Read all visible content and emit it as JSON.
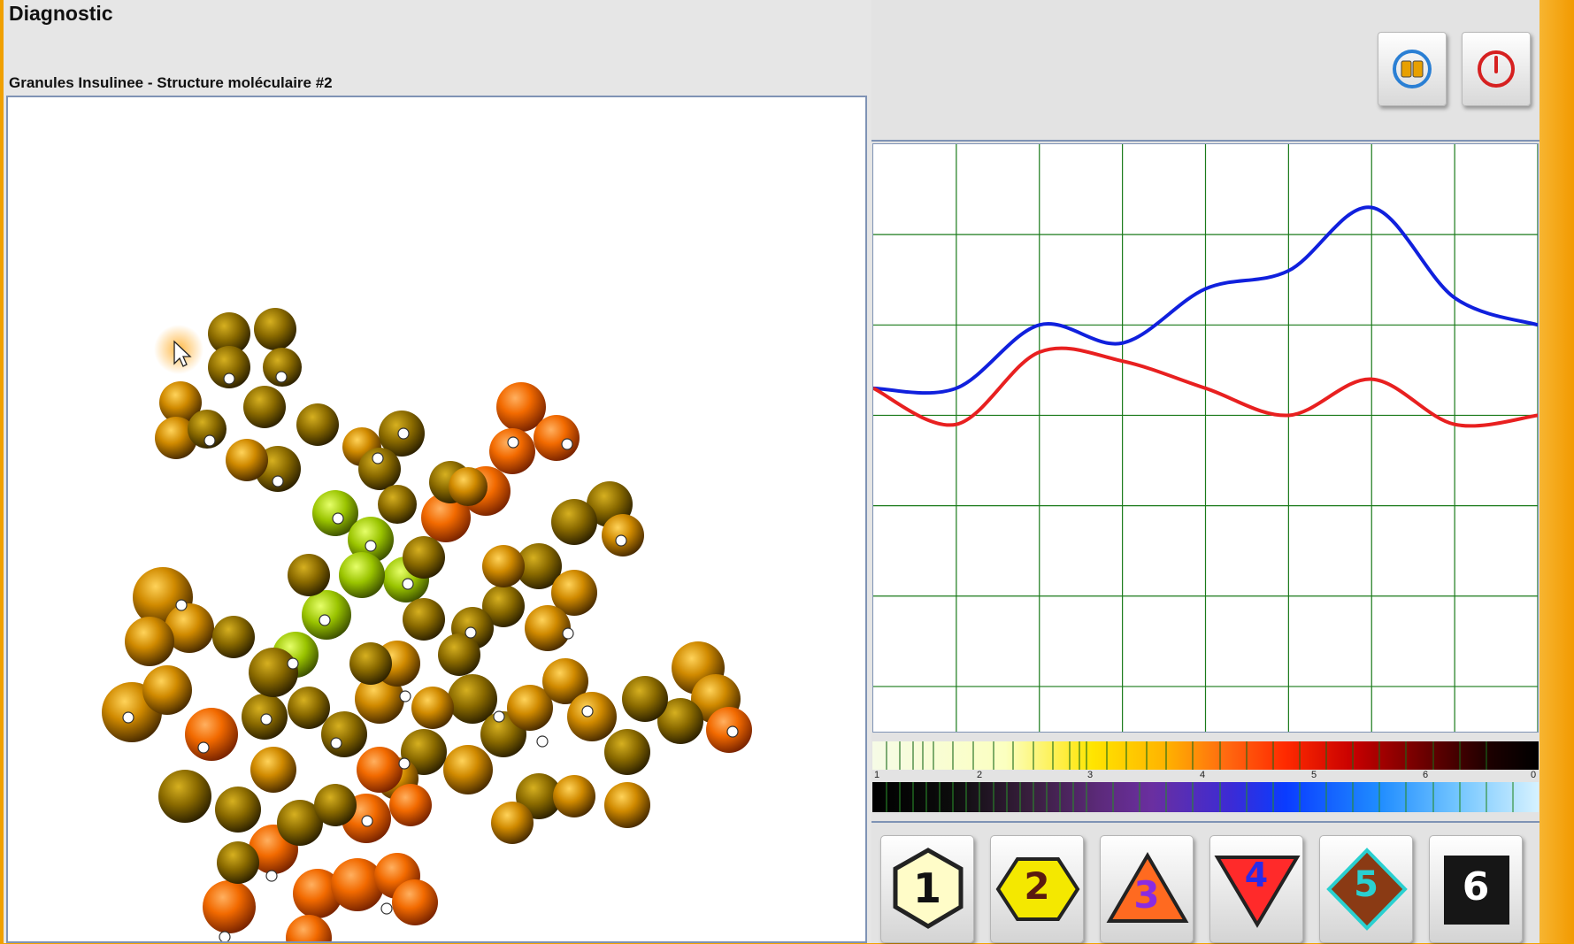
{
  "window": {
    "title": "Diagnostic"
  },
  "viewer": {
    "subtitle": "Granules Insulinee - Structure moléculaire #2"
  },
  "toolbar": {
    "buttons": [
      {
        "icon": "book-icon",
        "accent": "#2a7fd4"
      },
      {
        "icon": "power-icon",
        "accent": "#d62020"
      }
    ]
  },
  "chart_data": {
    "type": "line",
    "grid": true,
    "grid_color": "#1a7a1a",
    "x": [
      0,
      1,
      2,
      3,
      4,
      5,
      6,
      7,
      8
    ],
    "series": [
      {
        "color": "#1020dd",
        "values": [
          2.7,
          2.7,
          2.0,
          2.2,
          1.6,
          1.4,
          0.7,
          1.7,
          2.0
        ]
      },
      {
        "color": "#e82020",
        "values": [
          2.7,
          3.1,
          2.3,
          2.4,
          2.7,
          3.0,
          2.6,
          3.1,
          3.0
        ]
      }
    ],
    "ylim": [
      0,
      6.5
    ]
  },
  "spectrum": {
    "scale_labels": [
      "1",
      "2",
      "3",
      "4",
      "5",
      "6",
      "0"
    ]
  },
  "symbols": [
    {
      "label": "1",
      "shape": "hexagon",
      "fill": "#fffcc8",
      "stroke": "#222222",
      "text_color": "#111111"
    },
    {
      "label": "2",
      "shape": "hexagon-flat",
      "fill": "#f4e800",
      "stroke": "#222222",
      "text_color": "#5a1a10"
    },
    {
      "label": "3",
      "shape": "triangle",
      "fill": "#ff6a20",
      "stroke": "#222222",
      "text_color": "#8a2be2"
    },
    {
      "label": "4",
      "shape": "triangle-down",
      "fill": "#ff2a2a",
      "stroke": "#222222",
      "text_color": "#2a2ae8"
    },
    {
      "label": "5",
      "shape": "diamond",
      "fill": "#8a3a14",
      "stroke": "#2ad0d0",
      "text_color": "#2ad0d0"
    },
    {
      "label": "6",
      "shape": "square",
      "fill": "#161616",
      "stroke": "#161616",
      "text_color": "#ffffff"
    }
  ]
}
